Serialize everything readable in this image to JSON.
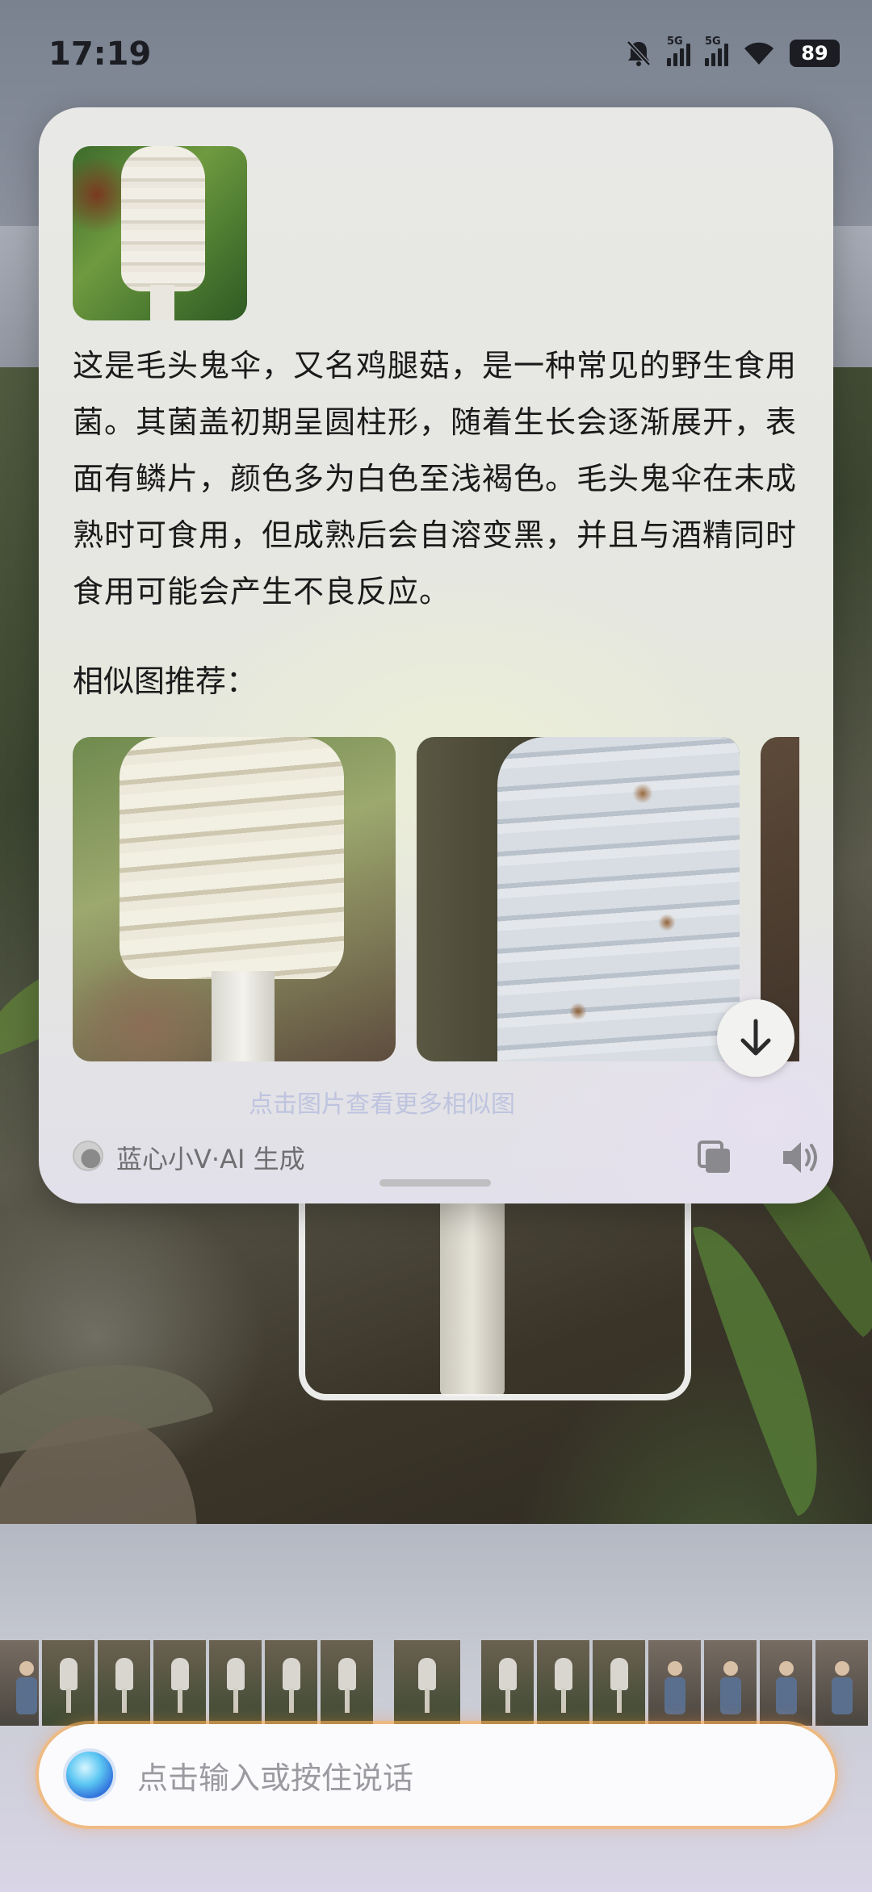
{
  "status_bar": {
    "time": "17:19",
    "network_tag_1": "5G",
    "network_tag_2": "5G",
    "battery": "89"
  },
  "card": {
    "answer": "这是毛头鬼伞，又名鸡腿菇，是一种常见的野生食用菌。其菌盖初期呈圆柱形，随着生长会逐渐展开，表面有鳞片，颜色多为白色至浅褐色。毛头鬼伞在未成熟时可食用，但成熟后会自溶变黑，并且与酒精同时食用可能会产生不良反应。",
    "similar_label": "相似图推荐：",
    "faded_hint": "点击图片查看更多相似图",
    "source_label": "蓝心小V·AI 生成"
  },
  "input_bar": {
    "placeholder": "点击输入或按住说话"
  },
  "colors": {
    "accent_glow": "#ffb45a",
    "ai_orb": "#2a63d8"
  },
  "icons": [
    "mute-bell-icon",
    "signal-icon",
    "wifi-icon",
    "battery-icon",
    "arrow-down-icon",
    "copy-icon",
    "speaker-icon",
    "ai-orb-icon"
  ]
}
